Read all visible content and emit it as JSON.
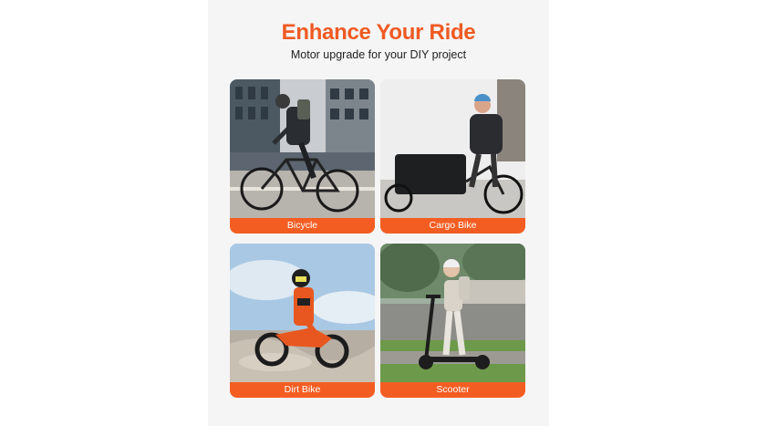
{
  "header": {
    "title": "Enhance Your Ride",
    "subtitle": "Motor upgrade for your DIY project"
  },
  "cards": [
    {
      "label": "Bicycle"
    },
    {
      "label": "Cargo Bike"
    },
    {
      "label": "Dirt Bike"
    },
    {
      "label": "Scooter"
    }
  ],
  "colors": {
    "accent": "#f05a22",
    "label_bg": "#f45d22",
    "panel_bg": "#f5f5f5"
  }
}
